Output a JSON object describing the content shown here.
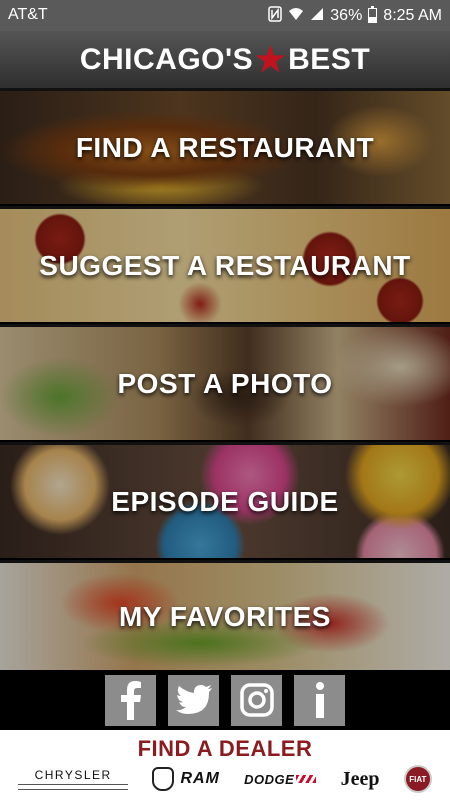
{
  "status_bar": {
    "carrier": "AT&T",
    "battery": "36%",
    "time": "8:25 AM",
    "icons": [
      "nfc-icon",
      "wifi-icon",
      "signal-icon",
      "battery-icon"
    ]
  },
  "header": {
    "title_left": "CHICAGO'S",
    "title_star": "★",
    "title_right": "BEST"
  },
  "menu": {
    "items": [
      {
        "label": "FIND A RESTAURANT"
      },
      {
        "label": "SUGGEST A RESTAURANT"
      },
      {
        "label": "POST A PHOTO"
      },
      {
        "label": "EPISODE GUIDE"
      },
      {
        "label": "MY FAVORITES"
      }
    ]
  },
  "social": {
    "buttons": [
      {
        "icon": "facebook-icon",
        "glyph": "f"
      },
      {
        "icon": "twitter-icon",
        "glyph": "t"
      },
      {
        "icon": "instagram-icon",
        "glyph": "ig"
      },
      {
        "icon": "info-icon",
        "glyph": "i"
      }
    ]
  },
  "dealer": {
    "title": "FIND A DEALER",
    "brands": {
      "chrysler": "CHRYSLER",
      "ram": "RAM",
      "dodge": "DODGE",
      "jeep": "Jeep",
      "fiat": "FIAT"
    }
  },
  "colors": {
    "accent_star": "#c1121f",
    "dealer_red": "#8b1b1f",
    "social_gray": "#8c8c8c"
  }
}
